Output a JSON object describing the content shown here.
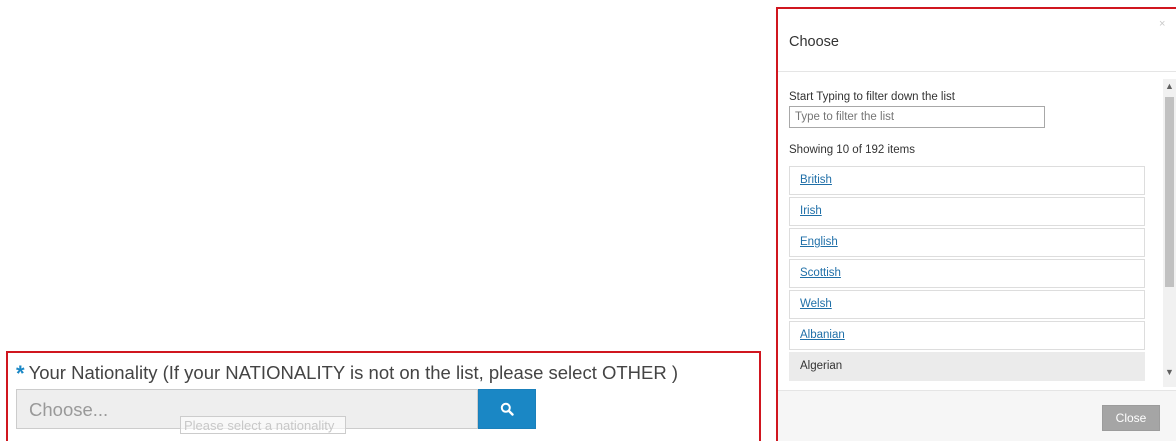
{
  "form": {
    "required_marker": "*",
    "label": "Your Nationality (If your NATIONALITY is not on the list, please select OTHER )",
    "input_placeholder": "Choose...",
    "search_icon": "search-icon",
    "tooltip": "Please select a nationality"
  },
  "modal": {
    "title": "Choose",
    "close_x": "×",
    "filter_label": "Start Typing to filter down the list",
    "filter_placeholder": "Type to filter the list",
    "count_text": "Showing 10 of 192 items",
    "items": [
      {
        "label": "British",
        "active": false
      },
      {
        "label": "Irish",
        "active": false
      },
      {
        "label": "English",
        "active": false
      },
      {
        "label": "Scottish",
        "active": false
      },
      {
        "label": "Welsh",
        "active": false
      },
      {
        "label": "Albanian",
        "active": false
      },
      {
        "label": "Algerian",
        "active": true
      }
    ],
    "close_button": "Close"
  },
  "colors": {
    "accent": "#1a87c5",
    "highlight_border": "#d0161f",
    "link": "#1f6fa8"
  }
}
